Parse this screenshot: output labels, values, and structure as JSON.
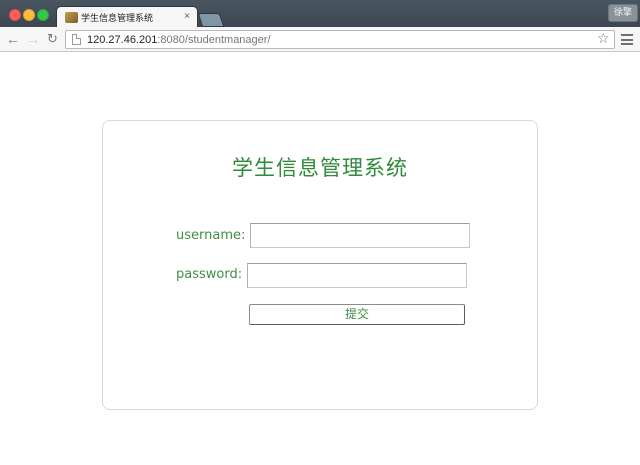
{
  "browser": {
    "tab": {
      "title": "学生信息管理系统",
      "close_glyph": "×"
    },
    "profile_button": "徐擎",
    "toolbar": {
      "back_glyph": "←",
      "forward_glyph": "→",
      "reload_glyph": "↻",
      "url_host": "120.27.46.201",
      "url_rest": ":8080/studentmanager/",
      "star_glyph": "☆"
    }
  },
  "login": {
    "title": "学生信息管理系统",
    "username_label": "username:",
    "username_value": "",
    "password_label": "password:",
    "password_value": "",
    "submit_label": "提交"
  },
  "colors": {
    "accent_green": "#2e8b3a",
    "label_green": "#3d8f46"
  }
}
